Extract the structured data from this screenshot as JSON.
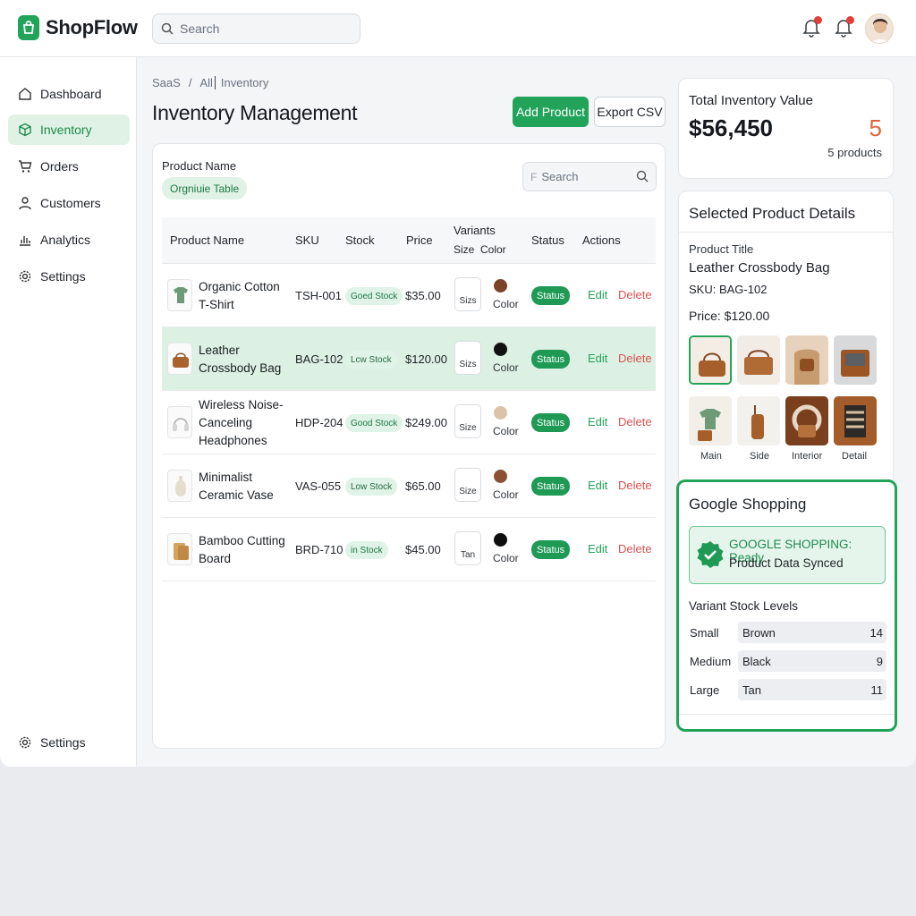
{
  "app": {
    "name": "ShopFlow",
    "search_placeholder": "Search",
    "accent": "#22a35a"
  },
  "sidebar": {
    "items": [
      {
        "label": "Dashboard",
        "icon": "home-icon"
      },
      {
        "label": "Inventory",
        "icon": "box-icon",
        "active": true
      },
      {
        "label": "Orders",
        "icon": "cart-icon"
      },
      {
        "label": "Customers",
        "icon": "user-icon"
      },
      {
        "label": "Analytics",
        "icon": "bar-chart-icon"
      },
      {
        "label": "Settings",
        "icon": "gear-icon"
      }
    ],
    "bottom_settings": "Settings"
  },
  "breadcrumb": [
    "SaaS",
    "/",
    "All",
    "Inventory"
  ],
  "page": {
    "title": "Inventory Management",
    "add_label": "Add Product",
    "export_label": "Export CSV"
  },
  "filter": {
    "label": "Product Name",
    "chip": "Orgniuie Table",
    "search_placeholder": "Search",
    "search_prefix": "F"
  },
  "table": {
    "headers": {
      "name": "Product Name",
      "sku": "SKU",
      "stock": "Stock",
      "price": "Price",
      "variants": "Variants",
      "size": "Size",
      "color": "Color",
      "status": "Status",
      "actions": "Actions"
    },
    "rows": [
      {
        "name": "Organic Cotton T-Shirt",
        "sku": "TSH-001",
        "stock": "Goed Stock",
        "price": "$35.00",
        "size": "Sizs",
        "color": "Color",
        "status": "Status",
        "edit": "Edit",
        "delete": "Delete",
        "swatch": "#7a4328"
      },
      {
        "name": "Leather Crossbody Bag",
        "sku": "BAG-102",
        "stock": "Lcw Stock",
        "price": "$120.00",
        "size": "Sizs",
        "color": "Color",
        "status": "Status",
        "edit": "Edit",
        "delete": "Delete",
        "swatch": "#111111"
      },
      {
        "name": "Wireless Noise-Canceling Headphones",
        "sku": "HDP-204",
        "stock": "Good Stock",
        "price": "$249.00",
        "size": "Size",
        "color": "Color",
        "status": "Status",
        "edit": "Edit",
        "delete": "Delete",
        "swatch": "#dcc2a8"
      },
      {
        "name": "Minimalist Ceramic Vase",
        "sku": "VAS-055",
        "stock": "Low Stock",
        "price": "$65.00",
        "size": "Size",
        "color": "Color",
        "status": "Status",
        "edit": "Edit",
        "delete": "Delete",
        "swatch": "#8a5233"
      },
      {
        "name": "Bamboo Cutting Board",
        "sku": "BRD-710",
        "stock": "in Stock",
        "price": "$45.00",
        "size": "Tan",
        "color": "Color",
        "status": "Status",
        "edit": "Edit",
        "delete": "Delete",
        "swatch": "#0e0e0e"
      }
    ]
  },
  "inventory_value": {
    "label": "Total Inventory Value",
    "value": "$56,450",
    "count": "5",
    "count_label": "5 products"
  },
  "details": {
    "heading": "Selected Product Details",
    "title_label": "Product Title",
    "title": "Leather Crossbody Bag",
    "sku": "SKU: BAG-102",
    "price": "Price: $120.00",
    "image_labels": [
      "Main",
      "Side",
      "Interior",
      "Detail"
    ]
  },
  "google": {
    "heading": "Google Shopping",
    "status_line1": "GOOGLE SHOPPING: Ready",
    "status_line2": "Product Data Synced",
    "variant_heading": "Variant Stock Levels",
    "variants": [
      {
        "size": "Small",
        "color": "Brown",
        "qty": "14"
      },
      {
        "size": "Medium",
        "color": "Black",
        "qty": "9"
      },
      {
        "size": "Large",
        "color": "Tan",
        "qty": "11"
      }
    ]
  }
}
